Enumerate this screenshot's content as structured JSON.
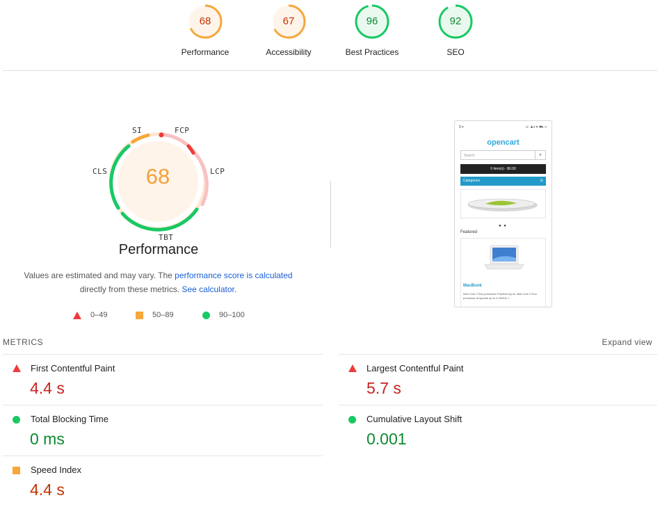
{
  "colors": {
    "fail": "#eb3b3b",
    "average": "#f6a73c",
    "pass": "#18c964",
    "link": "#1a5fd6"
  },
  "gauges": [
    {
      "score": "68",
      "label": "Performance",
      "rating": "average",
      "value_percent": 68
    },
    {
      "score": "67",
      "label": "Accessibility",
      "rating": "average",
      "value_percent": 67
    },
    {
      "score": "96",
      "label": "Best Practices",
      "rating": "pass",
      "value_percent": 96
    },
    {
      "score": "92",
      "label": "SEO",
      "rating": "pass",
      "value_percent": 92
    }
  ],
  "performance": {
    "score": "68",
    "title": "Performance",
    "segments": [
      "SI",
      "FCP",
      "LCP",
      "TBT",
      "CLS"
    ],
    "note_prefix": "Values are estimated and may vary. The ",
    "note_link1": "performance score is calculated",
    "note_mid": "directly from these metrics. ",
    "note_link2": "See calculator."
  },
  "legend": [
    {
      "icon": "triangle-icon",
      "label": "0–49"
    },
    {
      "icon": "square-icon",
      "label": "50–89"
    },
    {
      "icon": "circle-icon",
      "label": "90–100"
    }
  ],
  "thumbnail": {
    "logo": "opencart",
    "search_placeholder": "Search",
    "cart": "0 item(s) - $0.00",
    "categories": "Categories",
    "featured": "Featured",
    "product_name": "MacBook",
    "product_desc": "Intel Core 2 Duo processor Powered by an Intel Core 2 Duo processor at speeds up to 2.16GHz, t"
  },
  "metrics": {
    "heading": "METRICS",
    "expand_label": "Expand view",
    "items": [
      {
        "name": "First Contentful Paint",
        "value": "4.4 s",
        "rating": "fail"
      },
      {
        "name": "Largest Contentful Paint",
        "value": "5.7 s",
        "rating": "fail"
      },
      {
        "name": "Total Blocking Time",
        "value": "0 ms",
        "rating": "pass"
      },
      {
        "name": "Cumulative Layout Shift",
        "value": "0.001",
        "rating": "pass"
      },
      {
        "name": "Speed Index",
        "value": "4.4 s",
        "rating": "average"
      }
    ]
  }
}
